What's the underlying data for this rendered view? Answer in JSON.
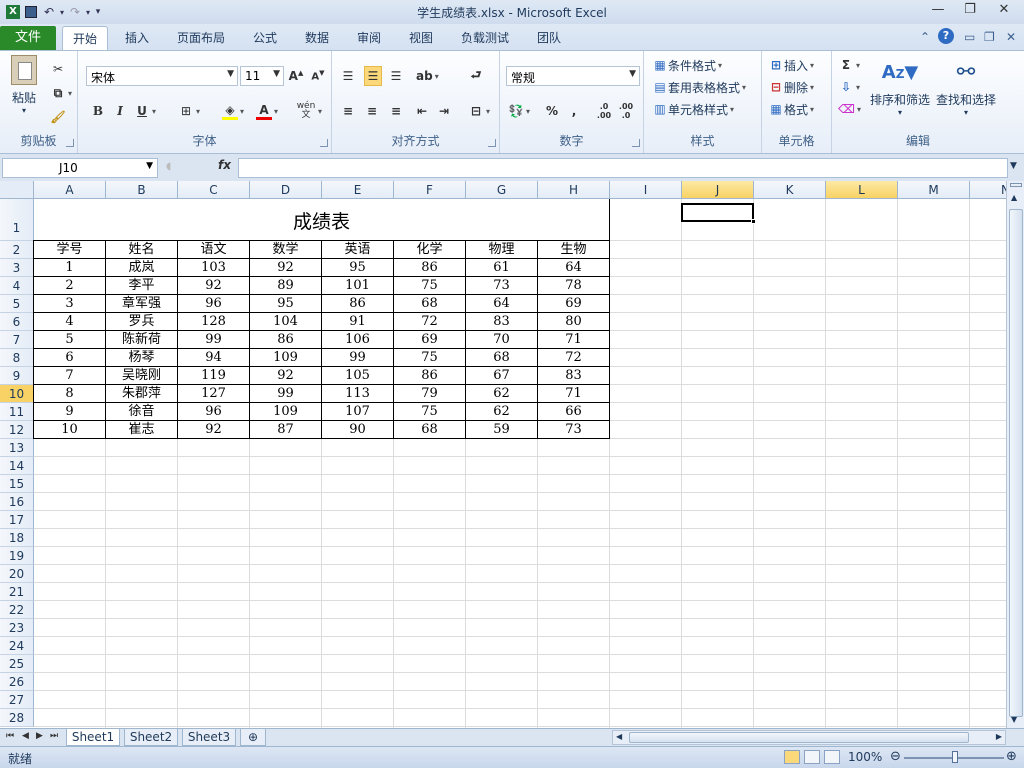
{
  "window": {
    "title": "学生成绩表.xlsx  -  Microsoft Excel",
    "controls": {
      "minimize": "—",
      "restore": "❐",
      "close": "✕"
    }
  },
  "qat": {
    "save_icon": "save-icon",
    "undo_icon": "undo-icon",
    "redo_icon": "redo-icon"
  },
  "ribbon_tabs": {
    "file": "文件",
    "tabs": [
      "开始",
      "插入",
      "页面布局",
      "公式",
      "数据",
      "审阅",
      "视图",
      "负载测试",
      "团队"
    ],
    "active": "开始"
  },
  "ribbon": {
    "clipboard": {
      "label": "剪贴板",
      "paste": "粘贴"
    },
    "font": {
      "label": "字体",
      "name": "宋体",
      "size": "11",
      "bold": "B",
      "italic": "I",
      "underline": "U",
      "fontcolor": "A",
      "wen": "wén 文"
    },
    "alignment": {
      "label": "对齐方式"
    },
    "number": {
      "label": "数字",
      "format": "常规",
      "percent": "%",
      "comma": ","
    },
    "styles": {
      "label": "样式",
      "cond": "条件格式",
      "table": "套用表格格式",
      "cell": "单元格样式"
    },
    "cells": {
      "label": "单元格",
      "insert": "插入",
      "delete": "删除",
      "format": "格式"
    },
    "editing": {
      "label": "编辑",
      "sort": "排序和筛选",
      "find": "查找和选择",
      "sum": "Σ"
    }
  },
  "formula_bar": {
    "name_box": "J10",
    "fx": "fx",
    "content": ""
  },
  "sheet": {
    "columns": [
      "A",
      "B",
      "C",
      "D",
      "E",
      "F",
      "G",
      "H",
      "I",
      "J",
      "K",
      "L",
      "M",
      "N"
    ],
    "highlighted_columns": [
      "J",
      "L"
    ],
    "rows": [
      "1",
      "2",
      "3",
      "4",
      "5",
      "6",
      "7",
      "8",
      "9",
      "10",
      "11",
      "12",
      "13",
      "14",
      "15",
      "16",
      "17",
      "18",
      "19",
      "20",
      "21",
      "22",
      "23",
      "24",
      "25",
      "26",
      "27",
      "28"
    ],
    "highlighted_row": "10",
    "selected_cell": "J10",
    "table_title": "成绩表",
    "headers": [
      "学号",
      "姓名",
      "语文",
      "数学",
      "英语",
      "化学",
      "物理",
      "生物"
    ],
    "data": [
      [
        "1",
        "成岚",
        "103",
        "92",
        "95",
        "86",
        "61",
        "64"
      ],
      [
        "2",
        "李平",
        "92",
        "89",
        "101",
        "75",
        "73",
        "78"
      ],
      [
        "3",
        "章军强",
        "96",
        "95",
        "86",
        "68",
        "64",
        "69"
      ],
      [
        "4",
        "罗兵",
        "128",
        "104",
        "91",
        "72",
        "83",
        "80"
      ],
      [
        "5",
        "陈新荷",
        "99",
        "86",
        "106",
        "69",
        "70",
        "71"
      ],
      [
        "6",
        "杨琴",
        "94",
        "109",
        "99",
        "75",
        "68",
        "72"
      ],
      [
        "7",
        "吴晓刚",
        "119",
        "92",
        "105",
        "86",
        "67",
        "83"
      ],
      [
        "8",
        "朱郡萍",
        "127",
        "99",
        "113",
        "79",
        "62",
        "71"
      ],
      [
        "9",
        "徐音",
        "96",
        "109",
        "107",
        "75",
        "62",
        "66"
      ],
      [
        "10",
        "崔志",
        "92",
        "87",
        "90",
        "68",
        "59",
        "73"
      ]
    ]
  },
  "sheet_tabs": {
    "tabs": [
      "Sheet1",
      "Sheet2",
      "Sheet3"
    ],
    "active": "Sheet1"
  },
  "status": {
    "ready": "就绪",
    "zoom": "100%"
  }
}
